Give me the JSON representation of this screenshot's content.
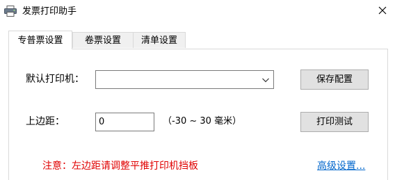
{
  "window": {
    "title": "发票打印助手",
    "icon": "printer-icon",
    "close_icon": "close-icon"
  },
  "tabs": [
    {
      "label": "专普票设置",
      "active": true
    },
    {
      "label": "卷票设置",
      "active": false
    },
    {
      "label": "清单设置",
      "active": false
    }
  ],
  "form": {
    "printer_label": "默认打印机：",
    "printer_value": "",
    "margin_label": "上边距：",
    "margin_value": "0",
    "margin_hint": "（-30 ~ 30 毫米）"
  },
  "buttons": {
    "save": "保存配置",
    "test": "打印测试"
  },
  "notice": "注意：左边距请调整平推打印机挡板",
  "advanced_link": "高级设置..."
}
